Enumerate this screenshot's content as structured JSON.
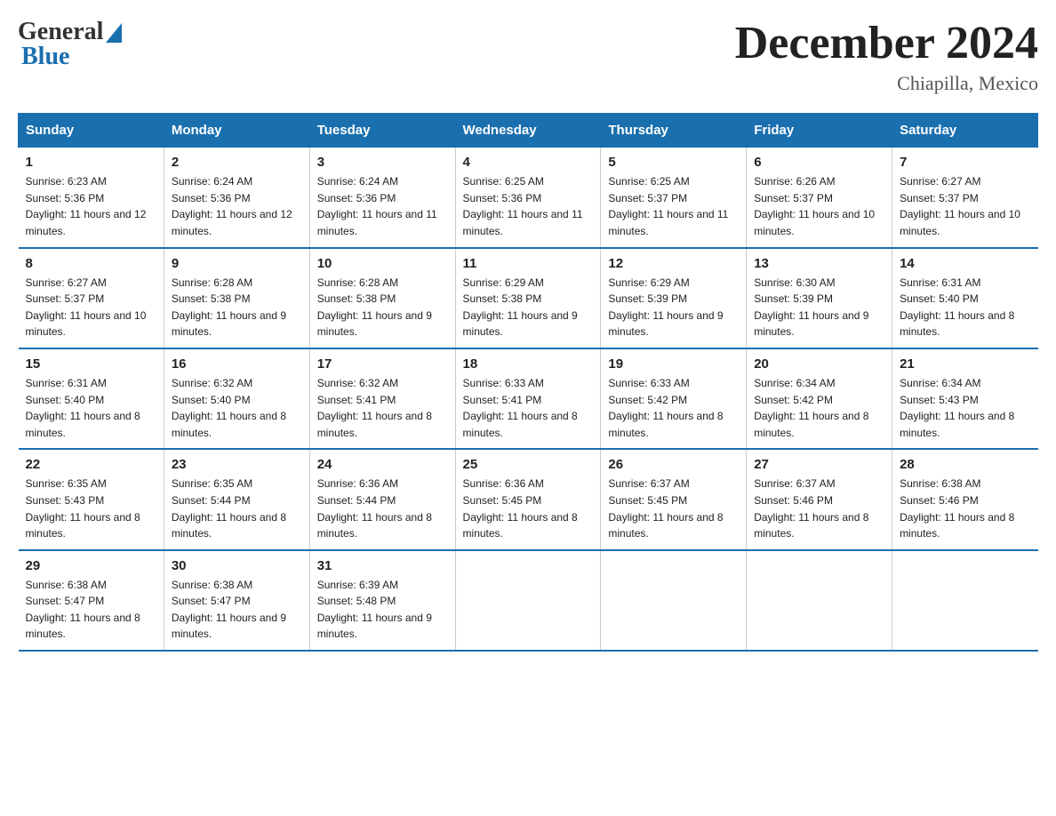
{
  "header": {
    "logo_general": "General",
    "logo_blue": "Blue",
    "main_title": "December 2024",
    "subtitle": "Chiapilla, Mexico"
  },
  "calendar": {
    "days_of_week": [
      "Sunday",
      "Monday",
      "Tuesday",
      "Wednesday",
      "Thursday",
      "Friday",
      "Saturday"
    ],
    "weeks": [
      [
        {
          "day": "1",
          "sunrise": "6:23 AM",
          "sunset": "5:36 PM",
          "daylight": "11 hours and 12 minutes."
        },
        {
          "day": "2",
          "sunrise": "6:24 AM",
          "sunset": "5:36 PM",
          "daylight": "11 hours and 12 minutes."
        },
        {
          "day": "3",
          "sunrise": "6:24 AM",
          "sunset": "5:36 PM",
          "daylight": "11 hours and 11 minutes."
        },
        {
          "day": "4",
          "sunrise": "6:25 AM",
          "sunset": "5:36 PM",
          "daylight": "11 hours and 11 minutes."
        },
        {
          "day": "5",
          "sunrise": "6:25 AM",
          "sunset": "5:37 PM",
          "daylight": "11 hours and 11 minutes."
        },
        {
          "day": "6",
          "sunrise": "6:26 AM",
          "sunset": "5:37 PM",
          "daylight": "11 hours and 10 minutes."
        },
        {
          "day": "7",
          "sunrise": "6:27 AM",
          "sunset": "5:37 PM",
          "daylight": "11 hours and 10 minutes."
        }
      ],
      [
        {
          "day": "8",
          "sunrise": "6:27 AM",
          "sunset": "5:37 PM",
          "daylight": "11 hours and 10 minutes."
        },
        {
          "day": "9",
          "sunrise": "6:28 AM",
          "sunset": "5:38 PM",
          "daylight": "11 hours and 9 minutes."
        },
        {
          "day": "10",
          "sunrise": "6:28 AM",
          "sunset": "5:38 PM",
          "daylight": "11 hours and 9 minutes."
        },
        {
          "day": "11",
          "sunrise": "6:29 AM",
          "sunset": "5:38 PM",
          "daylight": "11 hours and 9 minutes."
        },
        {
          "day": "12",
          "sunrise": "6:29 AM",
          "sunset": "5:39 PM",
          "daylight": "11 hours and 9 minutes."
        },
        {
          "day": "13",
          "sunrise": "6:30 AM",
          "sunset": "5:39 PM",
          "daylight": "11 hours and 9 minutes."
        },
        {
          "day": "14",
          "sunrise": "6:31 AM",
          "sunset": "5:40 PM",
          "daylight": "11 hours and 8 minutes."
        }
      ],
      [
        {
          "day": "15",
          "sunrise": "6:31 AM",
          "sunset": "5:40 PM",
          "daylight": "11 hours and 8 minutes."
        },
        {
          "day": "16",
          "sunrise": "6:32 AM",
          "sunset": "5:40 PM",
          "daylight": "11 hours and 8 minutes."
        },
        {
          "day": "17",
          "sunrise": "6:32 AM",
          "sunset": "5:41 PM",
          "daylight": "11 hours and 8 minutes."
        },
        {
          "day": "18",
          "sunrise": "6:33 AM",
          "sunset": "5:41 PM",
          "daylight": "11 hours and 8 minutes."
        },
        {
          "day": "19",
          "sunrise": "6:33 AM",
          "sunset": "5:42 PM",
          "daylight": "11 hours and 8 minutes."
        },
        {
          "day": "20",
          "sunrise": "6:34 AM",
          "sunset": "5:42 PM",
          "daylight": "11 hours and 8 minutes."
        },
        {
          "day": "21",
          "sunrise": "6:34 AM",
          "sunset": "5:43 PM",
          "daylight": "11 hours and 8 minutes."
        }
      ],
      [
        {
          "day": "22",
          "sunrise": "6:35 AM",
          "sunset": "5:43 PM",
          "daylight": "11 hours and 8 minutes."
        },
        {
          "day": "23",
          "sunrise": "6:35 AM",
          "sunset": "5:44 PM",
          "daylight": "11 hours and 8 minutes."
        },
        {
          "day": "24",
          "sunrise": "6:36 AM",
          "sunset": "5:44 PM",
          "daylight": "11 hours and 8 minutes."
        },
        {
          "day": "25",
          "sunrise": "6:36 AM",
          "sunset": "5:45 PM",
          "daylight": "11 hours and 8 minutes."
        },
        {
          "day": "26",
          "sunrise": "6:37 AM",
          "sunset": "5:45 PM",
          "daylight": "11 hours and 8 minutes."
        },
        {
          "day": "27",
          "sunrise": "6:37 AM",
          "sunset": "5:46 PM",
          "daylight": "11 hours and 8 minutes."
        },
        {
          "day": "28",
          "sunrise": "6:38 AM",
          "sunset": "5:46 PM",
          "daylight": "11 hours and 8 minutes."
        }
      ],
      [
        {
          "day": "29",
          "sunrise": "6:38 AM",
          "sunset": "5:47 PM",
          "daylight": "11 hours and 8 minutes."
        },
        {
          "day": "30",
          "sunrise": "6:38 AM",
          "sunset": "5:47 PM",
          "daylight": "11 hours and 9 minutes."
        },
        {
          "day": "31",
          "sunrise": "6:39 AM",
          "sunset": "5:48 PM",
          "daylight": "11 hours and 9 minutes."
        },
        null,
        null,
        null,
        null
      ]
    ]
  }
}
